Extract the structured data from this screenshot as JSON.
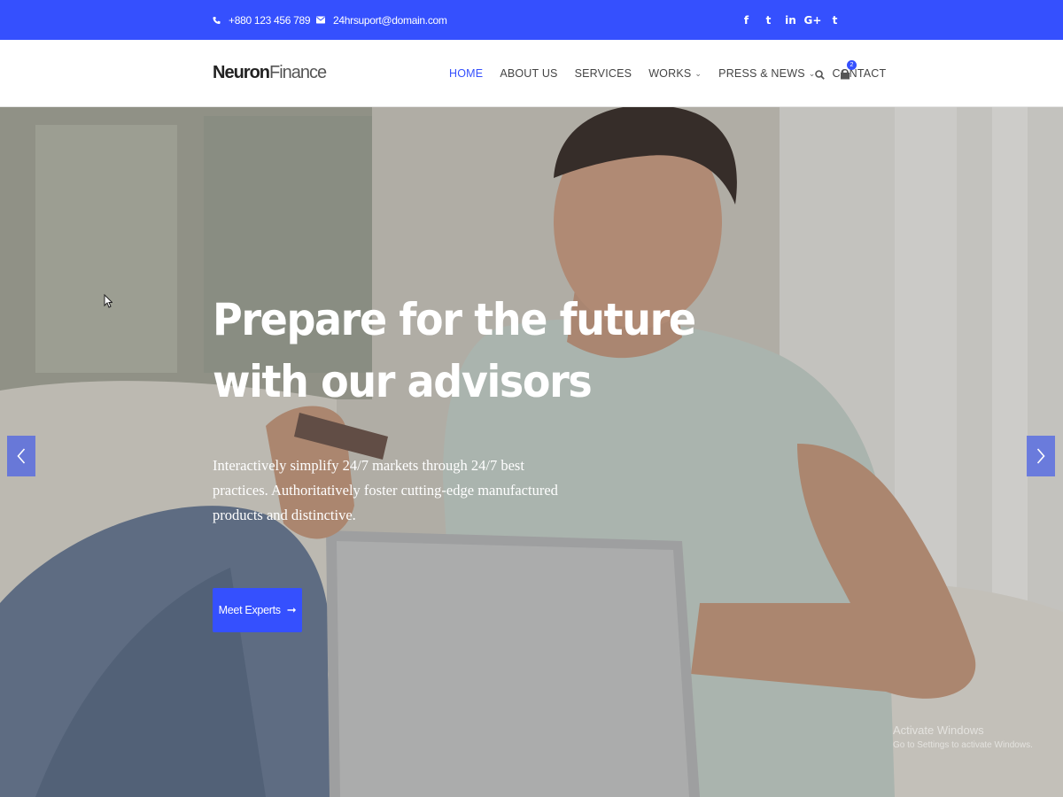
{
  "topbar": {
    "phone": "+880 123 456 789",
    "email": "24hrsuport@domain.com",
    "socials": [
      {
        "name": "facebook-icon",
        "glyph": "f"
      },
      {
        "name": "twitter-icon",
        "glyph": "t"
      },
      {
        "name": "linkedin-icon",
        "glyph": "in"
      },
      {
        "name": "google-plus-icon",
        "glyph": "G+"
      },
      {
        "name": "tumblr-icon",
        "glyph": "t"
      }
    ]
  },
  "header": {
    "logo_bold": "Neuron",
    "logo_light": "Finance",
    "nav": [
      {
        "label": "HOME",
        "active": true,
        "dropdown": false
      },
      {
        "label": "ABOUT US",
        "active": false,
        "dropdown": false
      },
      {
        "label": "SERVICES",
        "active": false,
        "dropdown": false
      },
      {
        "label": "WORKS",
        "active": false,
        "dropdown": true
      },
      {
        "label": "PRESS & NEWS",
        "active": false,
        "dropdown": true
      },
      {
        "label": "CONTACT",
        "active": false,
        "dropdown": false
      }
    ],
    "cart_count": "2"
  },
  "hero": {
    "title_line1": "Prepare for the future",
    "title_line2": "with our advisors",
    "text": "Interactively simplify 24/7 markets through 24/7 best practices. Authoritatively foster cutting-edge manufactured products and distinctive.",
    "cta_label": "Meet Experts",
    "cta_arrow": "➞"
  },
  "watermark": {
    "line1": "Activate Windows",
    "line2": "Go to Settings to activate Windows."
  },
  "colors": {
    "brand": "#3550fe",
    "nav_text": "#444444"
  }
}
